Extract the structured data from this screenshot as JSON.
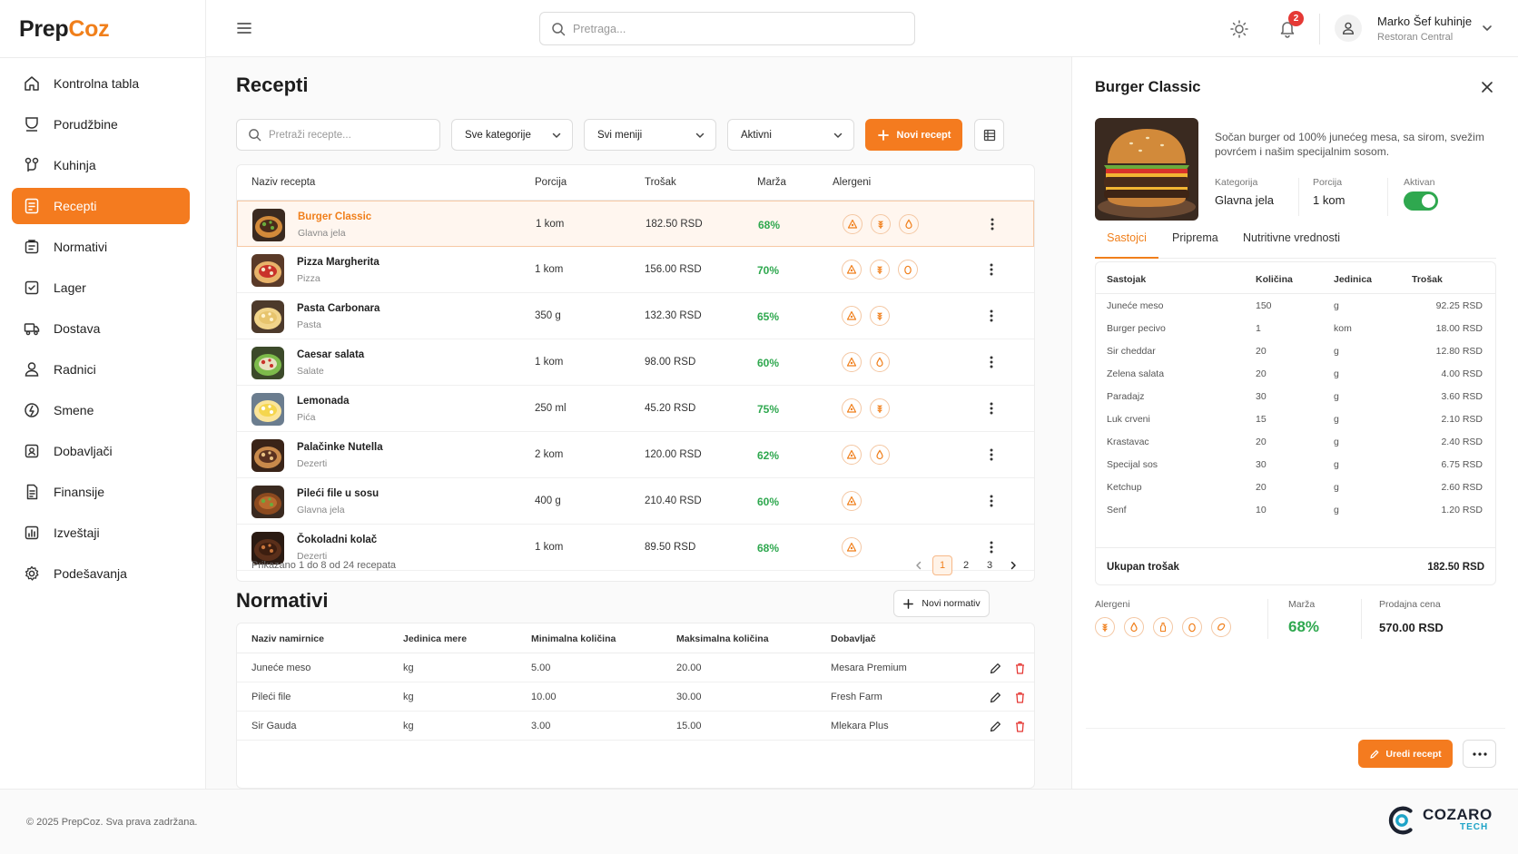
{
  "brand": {
    "logo_part1": "Prep",
    "logo_part2": "Coz",
    "accent": "#f47b1f"
  },
  "sidebar": {
    "items": [
      {
        "label": "Kontrolna tabla",
        "icon": "home-icon"
      },
      {
        "label": "Porudžbine",
        "icon": "orders-icon"
      },
      {
        "label": "Kuhinja",
        "icon": "kitchen-icon"
      },
      {
        "label": "Recepti",
        "icon": "recipe-icon",
        "active": true
      },
      {
        "label": "Normativi",
        "icon": "norms-icon"
      },
      {
        "label": "Lager",
        "icon": "inventory-icon"
      },
      {
        "label": "Dostava",
        "icon": "delivery-truck-icon"
      },
      {
        "label": "Radnici",
        "icon": "user-icon"
      },
      {
        "label": "Smene",
        "icon": "shifts-icon"
      },
      {
        "label": "Dobavljači",
        "icon": "suppliers-icon"
      },
      {
        "label": "Finansije",
        "icon": "finance-icon"
      },
      {
        "label": "Izveštaji",
        "icon": "reports-icon"
      },
      {
        "label": "Podešavanja",
        "icon": "gear-icon"
      }
    ]
  },
  "topbar": {
    "search_placeholder": "Pretraga...",
    "notifications": "2",
    "user_name": "Marko Šef kuhinje",
    "user_role": "Restoran Central"
  },
  "main": {
    "title": "Recepti",
    "filters": {
      "search_placeholder": "Pretraži recepte...",
      "category": "Sve kategorije",
      "menu": "Svi meniji",
      "status": "Aktivni",
      "new_button": "Novi recept"
    },
    "columns": [
      "Naziv recepta",
      "Porcija",
      "Trošak",
      "Marža",
      "Alergeni"
    ],
    "recipes": [
      {
        "name": "Burger Classic",
        "category": "Glavna jela",
        "portion": "1 kom",
        "cost": "182.50 RSD",
        "margin": "68%",
        "allergens": [
          "gluten-icon",
          "wheat-icon",
          "milk-icon"
        ]
      },
      {
        "name": "Pizza Margherita",
        "category": "Pizza",
        "portion": "1 kom",
        "cost": "156.00 RSD",
        "margin": "70%",
        "allergens": [
          "gluten-icon",
          "wheat-icon",
          "egg-icon"
        ]
      },
      {
        "name": "Pasta Carbonara",
        "category": "Pasta",
        "portion": "350 g",
        "cost": "132.30 RSD",
        "margin": "65%",
        "allergens": [
          "gluten-icon",
          "wheat-icon"
        ]
      },
      {
        "name": "Caesar salata",
        "category": "Salate",
        "portion": "1 kom",
        "cost": "98.00 RSD",
        "margin": "60%",
        "allergens": [
          "gluten-icon",
          "milk-icon"
        ]
      },
      {
        "name": "Lemonada",
        "category": "Pića",
        "portion": "250 ml",
        "cost": "45.20 RSD",
        "margin": "75%",
        "allergens": [
          "gluten-icon",
          "wheat-icon"
        ]
      },
      {
        "name": "Palačinke Nutella",
        "category": "Dezerti",
        "portion": "2 kom",
        "cost": "120.00 RSD",
        "margin": "62%",
        "allergens": [
          "gluten-icon",
          "milk-icon"
        ]
      },
      {
        "name": "Pileći file u sosu",
        "category": "Glavna jela",
        "portion": "400 g",
        "cost": "210.40 RSD",
        "margin": "60%",
        "allergens": [
          "gluten-icon"
        ]
      },
      {
        "name": "Čokoladni kolač",
        "category": "Dezerti",
        "portion": "1 kom",
        "cost": "89.50 RSD",
        "margin": "68%",
        "allergens": [
          "gluten-icon"
        ]
      }
    ],
    "pagination": {
      "info": "Prikazano 1 do 8 od 24 recepata",
      "pages": [
        "1",
        "2",
        "3"
      ],
      "current": "1"
    }
  },
  "normativi": {
    "title": "Normativi",
    "new_button": "Novi normativ",
    "columns": [
      "Naziv namirnice",
      "Jedinica mere",
      "Minimalna količina",
      "Maksimalna količina",
      "Dobavljač"
    ],
    "rows": [
      {
        "name": "Juneće meso",
        "unit": "kg",
        "min": "5.00",
        "max": "20.00",
        "supplier": "Mesara Premium"
      },
      {
        "name": "Pileći file",
        "unit": "kg",
        "min": "10.00",
        "max": "30.00",
        "supplier": "Fresh Farm"
      },
      {
        "name": "Sir Gauda",
        "unit": "kg",
        "min": "3.00",
        "max": "15.00",
        "supplier": "Mlekara Plus"
      }
    ]
  },
  "detail": {
    "title": "Burger Classic",
    "description": "Sočan burger od 100% junećeg mesa, sa sirom, svežim povrćem i našim specijalnim sosom.",
    "category_label": "Kategorija",
    "category": "Glavna jela",
    "portion_label": "Porcija",
    "portion": "1 kom",
    "active_label": "Aktivan",
    "active": true,
    "tabs": [
      "Sastojci",
      "Priprema",
      "Nutritivne vrednosti"
    ],
    "ingredient_columns": [
      "Sastojak",
      "Količina",
      "Jedinica",
      "Trošak"
    ],
    "ingredients": [
      {
        "name": "Juneće meso",
        "qty": "150",
        "unit": "g",
        "cost": "92.25 RSD"
      },
      {
        "name": "Burger pecivo",
        "qty": "1",
        "unit": "kom",
        "cost": "18.00 RSD"
      },
      {
        "name": "Sir cheddar",
        "qty": "20",
        "unit": "g",
        "cost": "12.80 RSD"
      },
      {
        "name": "Zelena salata",
        "qty": "20",
        "unit": "g",
        "cost": "4.00 RSD"
      },
      {
        "name": "Paradajz",
        "qty": "30",
        "unit": "g",
        "cost": "3.60 RSD"
      },
      {
        "name": "Luk crveni",
        "qty": "15",
        "unit": "g",
        "cost": "2.10 RSD"
      },
      {
        "name": "Krastavac",
        "qty": "20",
        "unit": "g",
        "cost": "2.40 RSD"
      },
      {
        "name": "Specijal sos",
        "qty": "30",
        "unit": "g",
        "cost": "6.75 RSD"
      },
      {
        "name": "Ketchup",
        "qty": "20",
        "unit": "g",
        "cost": "2.60 RSD"
      },
      {
        "name": "Senf",
        "qty": "10",
        "unit": "g",
        "cost": "1.20 RSD"
      }
    ],
    "total_label": "Ukupan trošak",
    "total": "182.50 RSD",
    "allergens_label": "Alergeni",
    "allergens": [
      "wheat-icon",
      "milk-icon",
      "bottle-icon",
      "egg-icon",
      "nut-icon"
    ],
    "margin_label": "Marža",
    "margin": "68%",
    "price_label": "Prodajna cena",
    "price": "570.00 RSD",
    "edit_button": "Uredi recept"
  },
  "footer": {
    "copyright": "© 2025 PrepCoz. Sva prava zadržana.",
    "partner_name": "COZARO",
    "partner_sub": "TECH"
  }
}
